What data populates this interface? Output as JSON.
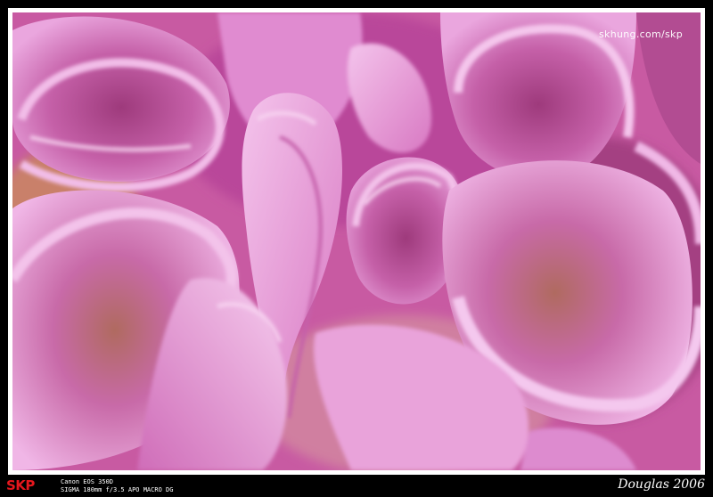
{
  "photo": {
    "subject": "pink-dahlia-petals-macro",
    "colors": {
      "base": "#c9579f",
      "highlight": "#f0b8e6",
      "mid": "#e28fd0",
      "shadow": "#8a2a6a",
      "warm": "#d9a06a"
    }
  },
  "watermark": {
    "text": "skhung.com/skp"
  },
  "footer": {
    "logo": "SKP",
    "camera_line1": "Canon EOS 350D",
    "camera_line2": "SIGMA 180mm f/3.5 APO MACRO DG",
    "signature": "Douglas 2006",
    "logo_color": "#e5171d"
  }
}
